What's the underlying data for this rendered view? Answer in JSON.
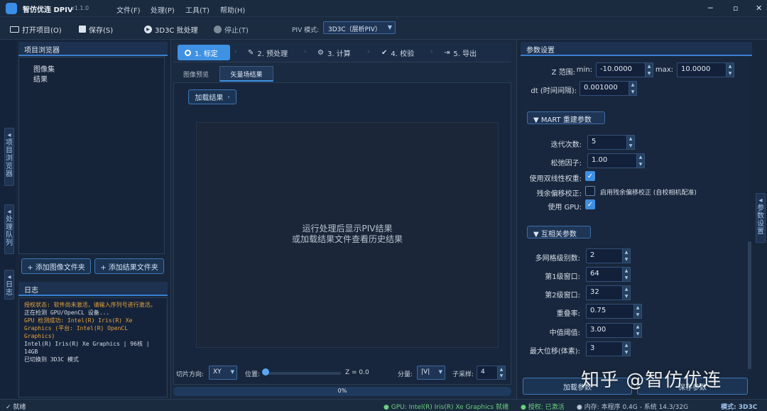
{
  "app": {
    "title": "智仿优连 DPIV",
    "version": "v1.1.0"
  },
  "menu": [
    "文件(F)",
    "处理(P)",
    "工具(T)",
    "帮助(H)"
  ],
  "toolbar": {
    "open": "打开项目(O)",
    "save": "保存(S)",
    "batch": "3D3C 批处理",
    "stop": "停止(T)",
    "piv_mode_label": "PIV 模式:",
    "piv_mode_value": "3D3C（层析PIV）"
  },
  "left_tabs": [
    "项目浏览器",
    "处理队列",
    "日志"
  ],
  "project": {
    "title": "项目浏览器",
    "tree": [
      "图像集",
      "结果"
    ],
    "add_images": "+ 添加图像文件夹",
    "add_results": "+ 添加结果文件夹"
  },
  "log": {
    "title": "日志",
    "lines": [
      {
        "text": "授权状态: 软件尚未激活，请输入序列号进行激活。",
        "color": "#e8a33a"
      },
      {
        "text": "正在检测 GPU/OpenCL 设备...",
        "color": "#d6dee8"
      },
      {
        "text": "GPU 检测成功: Intel(R) Iris(R) Xe Graphics (平台: Intel(R) OpenCL Graphics)",
        "color": "#e8a33a"
      },
      {
        "text": "Intel(R) Iris(R) Xe Graphics | 96核 | 14GB",
        "color": "#d6dee8"
      },
      {
        "text": "已切换到 3D3C 模式",
        "color": "#d6dee8"
      }
    ]
  },
  "steps": [
    "1. 标定",
    "2. 预处理",
    "3. 计算",
    "4. 校验",
    "5. 导出"
  ],
  "center": {
    "tabs": [
      "图像预览",
      "矢量场结果"
    ],
    "load_result": "加载结果",
    "placeholder_line1": "运行处理后显示PIV结果",
    "placeholder_line2": "或加载结果文件查看历史结果",
    "slice_dir_label": "切片方向:",
    "slice_dir_value": "XY",
    "position_label": "位置:",
    "z_value": "Z = 0.0",
    "component_label": "分量:",
    "component_value": "|V|",
    "subsample_label": "子采样:",
    "subsample_value": "4",
    "progress_text": "0%",
    "progress": 0
  },
  "params": {
    "title": "参数设置",
    "z_range_label": "Z 范围:",
    "min_label": "min:",
    "min_value": "-10.0000",
    "max_label": "max:",
    "max_value": "10.0000",
    "dt_label": "dt (时间间隔):",
    "dt_value": "0.001000",
    "mart_title": "▼  MART 重建参数",
    "iter_label": "迭代次数:",
    "iter_value": "5",
    "relax_label": "松弛因子:",
    "relax_value": "1.00",
    "bilinear_label": "使用双线性权重:",
    "residual_label": "残余偏移校正:",
    "residual_text": "启用残余偏移校正 (自校相机配准)",
    "gpu_label": "使用 GPU:",
    "corr_title": "▼  互相关参数",
    "levels_label": "多网格级别数:",
    "levels_value": "2",
    "win1_label": "第1级窗口:",
    "win1_value": "64",
    "win2_label": "第2级窗口:",
    "win2_value": "32",
    "overlap_label": "重叠率:",
    "overlap_value": "0.75",
    "median_label": "中值阈值:",
    "median_value": "3.00",
    "maxdisp_label": "最大位移(体素):",
    "maxdisp_value": "3",
    "load_params": "加载参数",
    "save_params": "保存参数"
  },
  "right_tab": "参数设置",
  "watermark": "知乎 @智仿优连",
  "status": {
    "ready": "✓ 就绪",
    "gpu": "● GPU: Intel(R) Iris(R) Xe Graphics 就绪",
    "license": "● 授权: 已激活",
    "memory": "● 内存: 本程序 0.4G - 系统 14.3/32G",
    "mode": "模式: 3D3C"
  }
}
